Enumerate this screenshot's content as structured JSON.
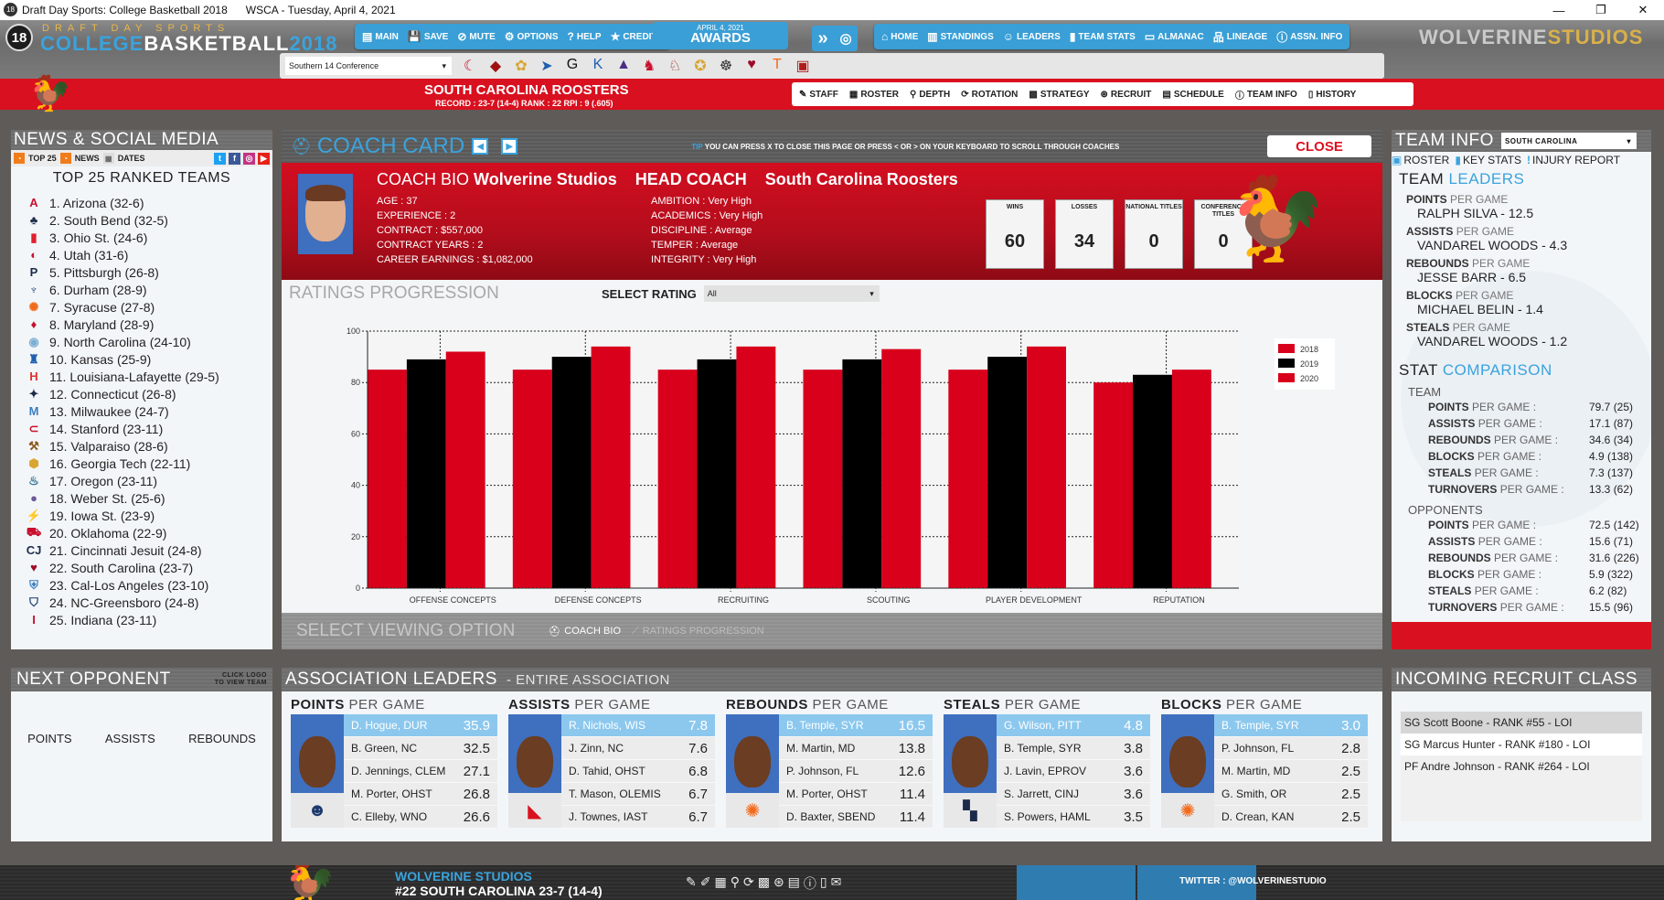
{
  "window": {
    "app_title": "Draft Day Sports: College Basketball 2018",
    "date_line": "WSCA - Tuesday, April 4, 2021",
    "minimize": "—",
    "restore": "❐",
    "close": "✕"
  },
  "brand": {
    "badge": "18",
    "top": "DRAFT DAY SPORTS",
    "college": "COLLEGE",
    "basketball": "BASKETBALL",
    "year": "2018",
    "studio_a": "WOLVERINE",
    "studio_b": "STUDIOS"
  },
  "main_nav": [
    {
      "icon": "▤",
      "label": "MAIN"
    },
    {
      "icon": "💾",
      "label": "SAVE"
    },
    {
      "icon": "⊘",
      "label": "MUTE"
    },
    {
      "icon": "⚙",
      "label": "OPTIONS"
    },
    {
      "icon": "?",
      "label": "HELP"
    },
    {
      "icon": "★",
      "label": "CREDITS"
    }
  ],
  "awards": {
    "date": "APRIL 4, 2021",
    "label": "AWARDS",
    "advance_icon": "»",
    "ball_icon": "◎"
  },
  "right_nav": [
    {
      "icon": "⌂",
      "label": "HOME"
    },
    {
      "icon": "▥",
      "label": "STANDINGS"
    },
    {
      "icon": "☺",
      "label": "LEADERS"
    },
    {
      "icon": "▮",
      "label": "TEAM STATS"
    },
    {
      "icon": "▭",
      "label": "ALMANAC"
    },
    {
      "icon": "品",
      "label": "LINEAGE"
    },
    {
      "icon": "ⓘ",
      "label": "ASSN. INFO"
    }
  ],
  "conference": {
    "selected": "Southern 14 Conference",
    "team_logos": [
      "☾",
      "◆",
      "✿",
      "➤",
      "G",
      "K",
      "▲",
      "♞",
      "♘",
      "✪",
      "☸",
      "♥",
      "T",
      "▣"
    ]
  },
  "team_bar": {
    "name": "SOUTH CAROLINA ROOSTERS",
    "record": "RECORD : 23-7 (14-4)   RANK : 22   RPI : 9 (.605)"
  },
  "team_nav": [
    {
      "icon": "✎",
      "label": "STAFF"
    },
    {
      "icon": "▦",
      "label": "ROSTER"
    },
    {
      "icon": "⚲",
      "label": "DEPTH"
    },
    {
      "icon": "⟳",
      "label": "ROTATION"
    },
    {
      "icon": "▩",
      "label": "STRATEGY"
    },
    {
      "icon": "⊛",
      "label": "RECRUIT"
    },
    {
      "icon": "▤",
      "label": "SCHEDULE"
    },
    {
      "icon": "ⓘ",
      "label": "TEAM INFO"
    },
    {
      "icon": "▯",
      "label": "HISTORY"
    }
  ],
  "news": {
    "title": "NEWS & SOCIAL MEDIA",
    "tabs": [
      "TOP 25",
      "NEWS",
      "DATES"
    ],
    "list_title": "TOP 25 RANKED TEAMS",
    "teams": [
      {
        "logo": "A",
        "text": "1. Arizona  (32-6)",
        "color": "#c8102e"
      },
      {
        "logo": "♣",
        "text": "2. South Bend  (32-5)",
        "color": "#1c2b4a"
      },
      {
        "logo": "▮",
        "text": "3. Ohio St.  (24-6)",
        "color": "#e0202e"
      },
      {
        "logo": "◐",
        "text": "4. Utah  (31-6)",
        "color": "#c8102e"
      },
      {
        "logo": "P",
        "text": "5. Pittsburgh  (26-8)",
        "color": "#1c2b4a"
      },
      {
        "logo": "♆",
        "text": "6. Durham  (28-9)",
        "color": "#1c3a6e"
      },
      {
        "logo": "✺",
        "text": "7. Syracuse  (27-8)",
        "color": "#f26a1b"
      },
      {
        "logo": "♦",
        "text": "8. Maryland  (28-9)",
        "color": "#c8102e"
      },
      {
        "logo": "◉",
        "text": "9. North Carolina  (24-10)",
        "color": "#7bafd4"
      },
      {
        "logo": "♜",
        "text": "10. Kansas  (25-9)",
        "color": "#1f5fae"
      },
      {
        "logo": "H",
        "text": "11. Louisiana-Lafayette  (29-5)",
        "color": "#e03030"
      },
      {
        "logo": "✦",
        "text": "12. Connecticut  (26-8)",
        "color": "#1c2b4a"
      },
      {
        "logo": "M",
        "text": "13. Milwaukee  (24-7)",
        "color": "#3a7fc1"
      },
      {
        "logo": "⊂",
        "text": "14. Stanford  (23-11)",
        "color": "#c8102e"
      },
      {
        "logo": "⚒",
        "text": "15. Valparaiso  (28-6)",
        "color": "#8a5a1c"
      },
      {
        "logo": "⬢",
        "text": "16. Georgia Tech  (22-11)",
        "color": "#d9a632"
      },
      {
        "logo": "♨",
        "text": "17. Oregon  (23-11)",
        "color": "#2f6d8f"
      },
      {
        "logo": "●",
        "text": "18. Weber St.  (25-6)",
        "color": "#6c5a9a"
      },
      {
        "logo": "⚡",
        "text": "19. Iowa St.  (23-9)",
        "color": "#c8102e"
      },
      {
        "logo": "⛟",
        "text": "20. Oklahoma  (22-9)",
        "color": "#c8102e"
      },
      {
        "logo": "CJ",
        "text": "21. Cincinnati Jesuit  (24-8)",
        "color": "#1c2b4a"
      },
      {
        "logo": "♥",
        "text": "22. South Carolina  (23-7)",
        "color": "#9e0a28"
      },
      {
        "logo": "⛨",
        "text": "23. Cal-Los Angeles  (23-10)",
        "color": "#3a7fc1"
      },
      {
        "logo": "⛉",
        "text": "24. NC-Greensboro  (24-8)",
        "color": "#1c3a6e"
      },
      {
        "logo": "I",
        "text": "25. Indiana  (23-11)",
        "color": "#c8102e"
      }
    ]
  },
  "coach_card": {
    "title": "COACH CARD",
    "prev": "◀",
    "next": "▶",
    "tip_label": "TIP",
    "tip_text": "YOU CAN PRESS X TO CLOSE THIS PAGE OR PRESS < OR > ON YOUR KEYBOARD TO SCROLL THROUGH COACHES",
    "close_label": "CLOSE",
    "bio_prefix": "COACH  BIO",
    "coach_name": "Wolverine Studios",
    "role": "HEAD COACH",
    "team": "South Carolina Roosters",
    "left_attrs": [
      {
        "k": "AGE",
        "v": "37"
      },
      {
        "k": "EXPERIENCE",
        "v": "2"
      },
      {
        "k": "CONTRACT",
        "v": "$557,000"
      },
      {
        "k": "CONTRACT YEARS",
        "v": "2"
      },
      {
        "k": "CAREER EARNINGS",
        "v": "$1,082,000"
      }
    ],
    "right_attrs": [
      {
        "k": "AMBITION",
        "v": "Very High"
      },
      {
        "k": "ACADEMICS",
        "v": "Very High"
      },
      {
        "k": "DISCIPLINE",
        "v": "Average"
      },
      {
        "k": "TEMPER",
        "v": "Average"
      },
      {
        "k": "INTEGRITY",
        "v": "Very High"
      }
    ],
    "stats": [
      {
        "label": "WINS",
        "value": "60"
      },
      {
        "label": "LOSSES",
        "value": "34"
      },
      {
        "label": "NATIONAL TITLES",
        "value": "0"
      },
      {
        "label": "CONFERENCE TITLES",
        "value": "0"
      }
    ],
    "ratings_title": "RATINGS PROGRESSION",
    "select_rating_label": "SELECT RATING",
    "select_rating_value": "All",
    "view_option_title": "SELECT VIEWING OPTION",
    "view_options": [
      "COACH BIO",
      "RATINGS PROGRESSION"
    ]
  },
  "chart_data": {
    "type": "bar",
    "title": "RATINGS PROGRESSION",
    "categories": [
      "OFFENSE CONCEPTS",
      "DEFENSE CONCEPTS",
      "RECRUITING",
      "SCOUTING",
      "PLAYER DEVELOPMENT",
      "REPUTATION"
    ],
    "series": [
      {
        "name": "2018",
        "color": "#d9001b",
        "values": [
          85,
          85,
          85,
          85,
          85,
          80
        ]
      },
      {
        "name": "2019",
        "color": "#000000",
        "values": [
          89,
          90,
          89,
          89,
          90,
          83
        ]
      },
      {
        "name": "2020",
        "color": "#d9001b",
        "values": [
          92,
          94,
          94,
          93,
          94,
          85
        ]
      }
    ],
    "ylim": [
      0,
      100
    ],
    "yticks": [
      0,
      20,
      40,
      60,
      80,
      100
    ],
    "xlabel": "",
    "ylabel": "",
    "grid": true,
    "legend": "right"
  },
  "team_info": {
    "title": "TEAM INFO",
    "team_select": "SOUTH CAROLINA",
    "tabs": [
      "ROSTER",
      "KEY STATS",
      "INJURY REPORT"
    ],
    "leaders_a": "TEAM",
    "leaders_b": "LEADERS",
    "leaders": [
      {
        "stat": "POINTS",
        "suffix": "PER GAME",
        "value": "RALPH SILVA - 12.5"
      },
      {
        "stat": "ASSISTS",
        "suffix": "PER GAME",
        "value": "VANDAREL WOODS - 4.3"
      },
      {
        "stat": "REBOUNDS",
        "suffix": "PER GAME",
        "value": "JESSE BARR - 6.5"
      },
      {
        "stat": "BLOCKS",
        "suffix": "PER GAME",
        "value": "MICHAEL BELIN - 1.4"
      },
      {
        "stat": "STEALS",
        "suffix": "PER GAME",
        "value": "VANDAREL WOODS - 1.2"
      }
    ],
    "compare_a": "STAT",
    "compare_b": "COMPARISON",
    "team_label": "TEAM",
    "team_stats": [
      {
        "k": "POINTS",
        "s": "PER GAME :",
        "v": "79.7 (25)"
      },
      {
        "k": "ASSISTS",
        "s": "PER GAME :",
        "v": "17.1 (87)"
      },
      {
        "k": "REBOUNDS",
        "s": "PER GAME :",
        "v": "34.6 (34)"
      },
      {
        "k": "BLOCKS",
        "s": "PER GAME :",
        "v": "4.9 (138)"
      },
      {
        "k": "STEALS",
        "s": "PER GAME :",
        "v": "7.3 (137)"
      },
      {
        "k": "TURNOVERS",
        "s": "PER GAME :",
        "v": "13.3 (62)"
      }
    ],
    "opp_label": "OPPONENTS",
    "opp_stats": [
      {
        "k": "POINTS",
        "s": "PER GAME :",
        "v": "72.5 (142)"
      },
      {
        "k": "ASSISTS",
        "s": "PER GAME :",
        "v": "15.6 (71)"
      },
      {
        "k": "REBOUNDS",
        "s": "PER GAME :",
        "v": "31.6 (226)"
      },
      {
        "k": "BLOCKS",
        "s": "PER GAME :",
        "v": "5.9 (322)"
      },
      {
        "k": "STEALS",
        "s": "PER GAME :",
        "v": "6.2 (82)"
      },
      {
        "k": "TURNOVERS",
        "s": "PER GAME :",
        "v": "15.5 (96)"
      }
    ]
  },
  "next_opponent": {
    "title": "NEXT OPPONENT",
    "hint": "CLICK LOGO TO VIEW TEAM",
    "cols": [
      "POINTS",
      "ASSISTS",
      "REBOUNDS"
    ]
  },
  "assoc_leaders": {
    "title": "ASSOCIATION LEADERS",
    "subtitle": "- ENTIRE ASSOCIATION",
    "categories": [
      {
        "a": "POINTS",
        "b": "PER GAME",
        "logo": "☻",
        "rows": [
          [
            "D. Hogue, DUR",
            "35.9"
          ],
          [
            "B. Green, NC",
            "32.5"
          ],
          [
            "D. Jennings, CLEM",
            "27.1"
          ],
          [
            "M. Porter, OHST",
            "26.8"
          ],
          [
            "C. Elleby, WNO",
            "26.6"
          ]
        ]
      },
      {
        "a": "ASSISTS",
        "b": "PER GAME",
        "logo": "◣",
        "rows": [
          [
            "R. Nichols, WIS",
            "7.8"
          ],
          [
            "J. Zinn, NC",
            "7.6"
          ],
          [
            "D. Tahid, OHST",
            "6.8"
          ],
          [
            "T. Mason, OLEMIS",
            "6.7"
          ],
          [
            "J. Townes, IAST",
            "6.7"
          ]
        ]
      },
      {
        "a": "REBOUNDS",
        "b": "PER GAME",
        "logo": "✺",
        "rows": [
          [
            "B. Temple, SYR",
            "16.5"
          ],
          [
            "M. Martin, MD",
            "13.8"
          ],
          [
            "P. Johnson, FL",
            "12.6"
          ],
          [
            "M. Porter, OHST",
            "11.4"
          ],
          [
            "D. Baxter, SBEND",
            "11.4"
          ]
        ]
      },
      {
        "a": "STEALS",
        "b": "PER GAME",
        "logo": "▚",
        "rows": [
          [
            "G. Wilson, PITT",
            "4.8"
          ],
          [
            "B. Temple, SYR",
            "3.8"
          ],
          [
            "J. Lavin, EPROV",
            "3.6"
          ],
          [
            "S. Jarrett, CINJ",
            "3.6"
          ],
          [
            "S. Powers, HAML",
            "3.5"
          ]
        ]
      },
      {
        "a": "BLOCKS",
        "b": "PER GAME",
        "logo": "✺",
        "rows": [
          [
            "B. Temple, SYR",
            "3.0"
          ],
          [
            "P. Johnson, FL",
            "2.8"
          ],
          [
            "M. Martin, MD",
            "2.5"
          ],
          [
            "G. Smith, OR",
            "2.5"
          ],
          [
            "D. Crean, KAN",
            "2.5"
          ]
        ]
      }
    ]
  },
  "recruits": {
    "title": "INCOMING RECRUIT CLASS",
    "items": [
      "SG Scott Boone - RANK #55 - LOI",
      "SG Marcus Hunter - RANK #180 - LOI",
      "PF Andre Johnson - RANK #264 - LOI"
    ]
  },
  "footer": {
    "user": "WOLVERINE STUDIOS",
    "team_line": "#22 SOUTH CAROLINA 23-7 (14-4)",
    "icons": [
      "✎",
      "✐",
      "▦",
      "⚲",
      "⟳",
      "▩",
      "⊛",
      "▤",
      "ⓘ",
      "▯",
      "✉"
    ],
    "twitter": "TWITTER : @WOLVERINESTUDIO"
  },
  "colors": {
    "accent_blue": "#3aa3dd",
    "team_red": "#d9101f",
    "bar_red": "#d9001b",
    "bar_black": "#000000",
    "rooster": "#9e0a28"
  }
}
